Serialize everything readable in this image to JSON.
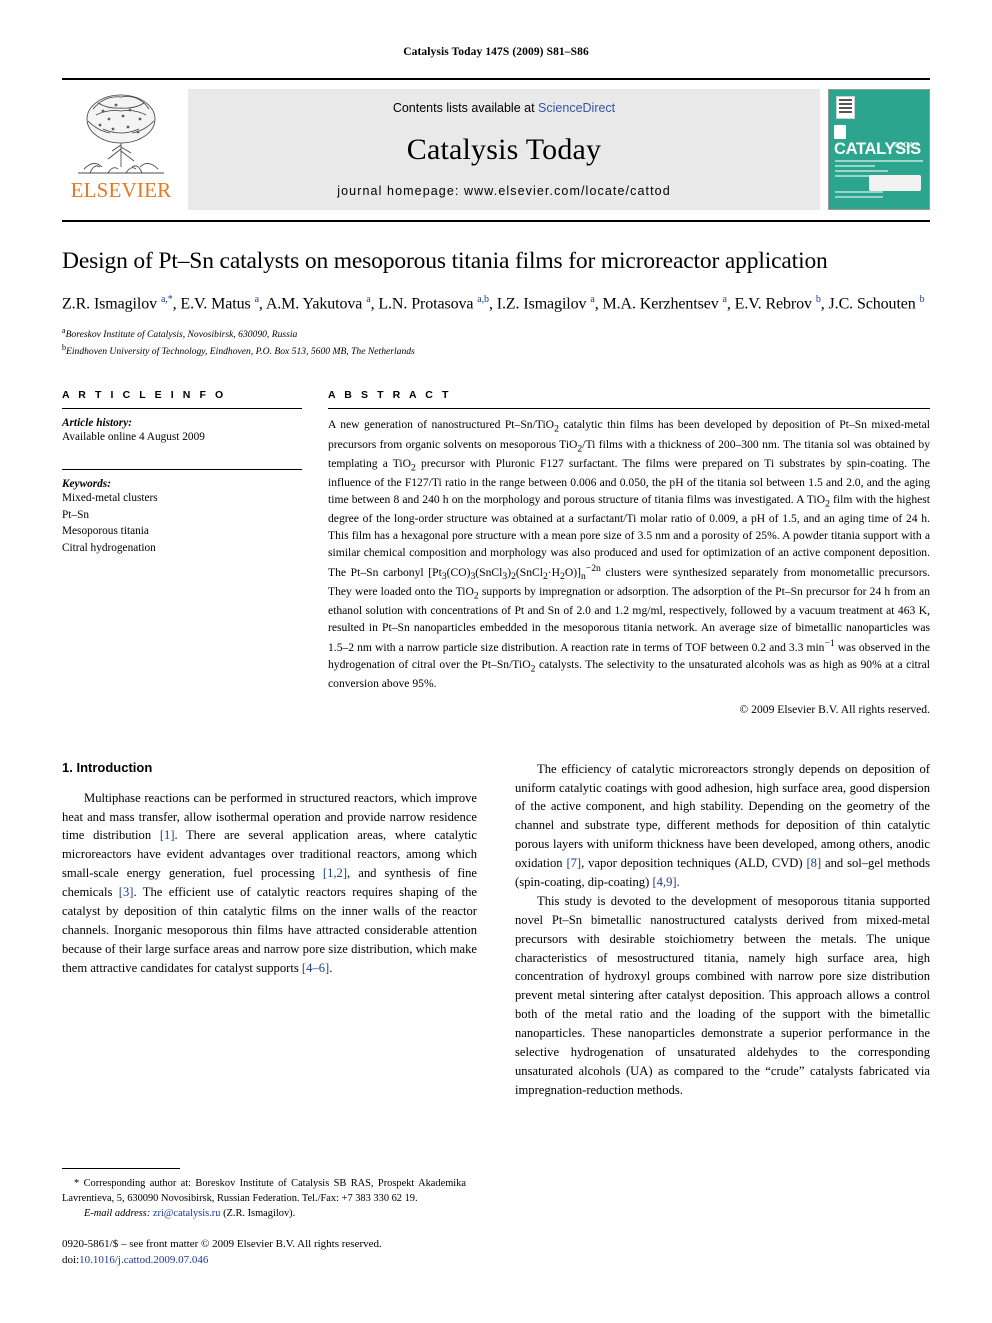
{
  "running_head": "Catalysis Today 147S (2009) S81–S86",
  "masthead": {
    "contents_prefix": "Contents lists available at",
    "sciencedirect": "ScienceDirect",
    "journal_name": "Catalysis Today",
    "homepage": "journal homepage: www.elsevier.com/locate/cattod",
    "elsevier_word": "ELSEVIER",
    "cover_title": "CATALYSIS",
    "cover_sub": "TODAY",
    "accent_orange": "#E87722",
    "link_blue": "#3a53a4",
    "cover_teal": "#2ba58e"
  },
  "article": {
    "title": "Design of Pt–Sn catalysts on mesoporous titania films for microreactor application",
    "authors_html": "Z.R. Ismagilov <sup>a,*</sup>, E.V. Matus <sup>a</sup>, A.M. Yakutova <sup>a</sup>, L.N. Protasova <sup>a,b</sup>, I.Z. Ismagilov <sup>a</sup>, M.A. Kerzhentsev <sup>a</sup>, E.V. Rebrov <sup>b</sup>, J.C. Schouten <sup>b</sup>",
    "affiliations": [
      {
        "marker": "a",
        "text": "Boreskov Institute of Catalysis, Novosibirsk, 630090, Russia"
      },
      {
        "marker": "b",
        "text": "Eindhoven University of Technology, Eindhoven, P.O. Box 513, 5600 MB, The Netherlands"
      }
    ]
  },
  "article_info": {
    "heading": "A R T I C L E   I N F O",
    "history_label": "Article history:",
    "history_value": "Available online 4 August 2009",
    "keywords_label": "Keywords:",
    "keywords": [
      "Mixed-metal clusters",
      "Pt–Sn",
      "Mesoporous titania",
      "Citral hydrogenation"
    ]
  },
  "abstract": {
    "heading": "A B S T R A C T",
    "body_html": "A new generation of nanostructured Pt–Sn/TiO<sub>2</sub> catalytic thin films has been developed by deposition of Pt–Sn mixed-metal precursors from organic solvents on mesoporous TiO<sub>2</sub>/Ti films with a thickness of 200–300 nm. The titania sol was obtained by templating a TiO<sub>2</sub> precursor with Pluronic F127 surfactant. The films were prepared on Ti substrates by spin-coating. The influence of the F127/Ti ratio in the range between 0.006 and 0.050, the pH of the titania sol between 1.5 and 2.0, and the aging time between 8 and 240 h on the morphology and porous structure of titania films was investigated. A TiO<sub>2</sub> film with the highest degree of the long-order structure was obtained at a surfactant/Ti molar ratio of 0.009, a pH of 1.5, and an aging time of 24 h. This film has a hexagonal pore structure with a mean pore size of 3.5 nm and a porosity of 25%. A powder titania support with a similar chemical composition and morphology was also produced and used for optimization of an active component deposition. The Pt–Sn carbonyl [Pt<sub>3</sub>(CO)<sub>3</sub>(SnCl<sub>3</sub>)<sub>2</sub>(SnCl<sub>2</sub>·H<sub>2</sub>O)]<sub>n</sub><sup>−2n</sup> clusters were synthesized separately from monometallic precursors. They were loaded onto the TiO<sub>2</sub> supports by impregnation or adsorption. The adsorption of the Pt–Sn precursor for 24 h from an ethanol solution with concentrations of Pt and Sn of 2.0 and 1.2 mg/ml, respectively, followed by a vacuum treatment at 463 K, resulted in Pt–Sn nanoparticles embedded in the mesoporous titania network. An average size of bimetallic nanoparticles was 1.5–2 nm with a narrow particle size distribution. A reaction rate in terms of TOF between 0.2 and 3.3 min<sup>−1</sup> was observed in the hydrogenation of citral over the Pt–Sn/TiO<sub>2</sub> catalysts. The selectivity to the unsaturated alcohols was as high as 90% at a citral conversion above 95%.",
    "copyright": "© 2009 Elsevier B.V. All rights reserved."
  },
  "introduction": {
    "heading": "1. Introduction",
    "left_paragraphs_html": [
      "Multiphase reactions can be performed in structured reactors, which improve heat and mass transfer, allow isothermal operation and provide narrow residence time distribution <span class=\"ref\">[1]</span>. There are several application areas, where catalytic microreactors have evident advantages over traditional reactors, among which small-scale energy generation, fuel processing <span class=\"ref\">[1,2]</span>, and synthesis of fine chemicals <span class=\"ref\">[3]</span>. The efficient use of catalytic reactors requires shaping of the catalyst by deposition of thin catalytic films on the inner walls of the reactor channels. Inorganic mesoporous thin films have attracted considerable attention because of their large surface areas and narrow pore size distribution, which make them attractive candidates for catalyst supports <span class=\"ref\">[4–6]</span>."
    ],
    "right_paragraphs_html": [
      "The efficiency of catalytic microreactors strongly depends on deposition of uniform catalytic coatings with good adhesion, high surface area, good dispersion of the active component, and high stability. Depending on the geometry of the channel and substrate type, different methods for deposition of thin catalytic porous layers with uniform thickness have been developed, among others, anodic oxidation <span class=\"ref\">[7]</span>, vapor deposition techniques (ALD, CVD) <span class=\"ref\">[8]</span> and sol–gel methods (spin-coating, dip-coating) <span class=\"ref\">[4,9]</span>.",
      "This study is devoted to the development of mesoporous titania supported novel Pt–Sn bimetallic nanostructured catalysts derived from mixed-metal precursors with desirable stoichiometry between the metals. The unique characteristics of mesostructured titania, namely high surface area, high concentration of hydroxyl groups combined with narrow pore size distribution prevent metal sintering after catalyst deposition. This approach allows a control both of the metal ratio and the loading of the support with the bimetallic nanoparticles. These nanoparticles demonstrate a superior performance in the selective hydrogenation of unsaturated aldehydes to the corresponding unsaturated alcohols (UA) as compared to the “crude” catalysts fabricated via impregnation-reduction methods."
    ]
  },
  "footnotes": {
    "corresponding_html": "* Corresponding author at: Boreskov Institute of Catalysis SB RAS, Prospekt Akademika Lavrentieva, 5, 630090 Novosibirsk, Russian Federation. Tel./Fax: +7 383 330 62 19.",
    "email_label": "E-mail address:",
    "email_value": "zri@catalysis.ru",
    "email_suffix": "(Z.R. Ismagilov).",
    "issn_line": "0920-5861/$ – see front matter © 2009 Elsevier B.V. All rights reserved.",
    "doi_label": "doi:",
    "doi_value": "10.1016/j.cattod.2009.07.046"
  }
}
